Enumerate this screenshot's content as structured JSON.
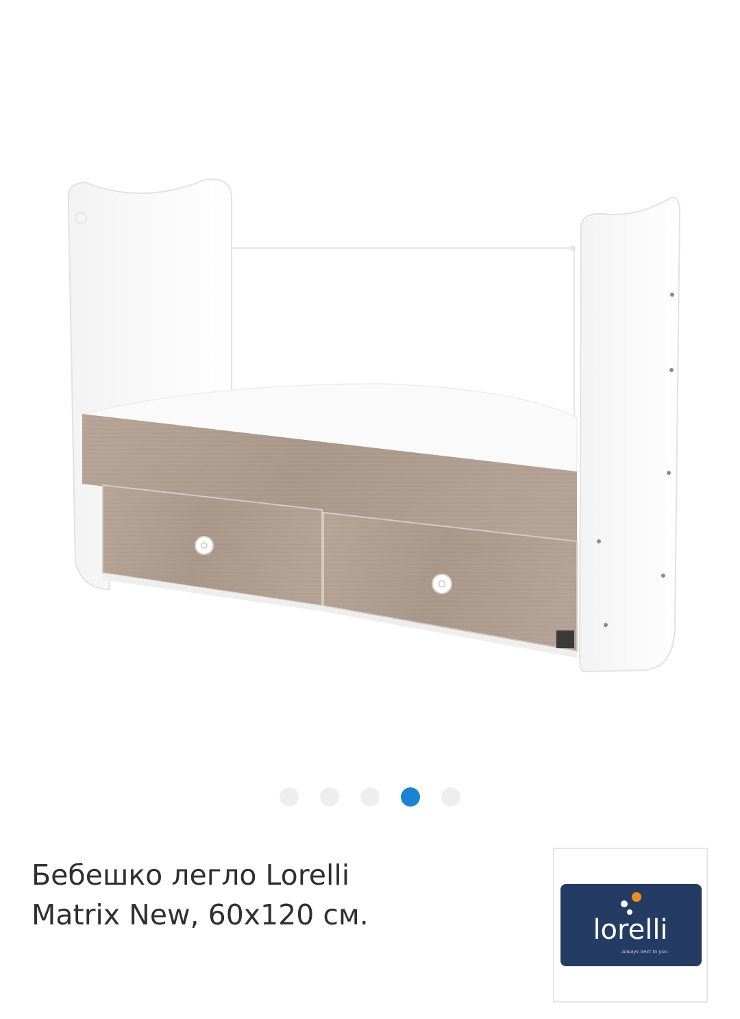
{
  "gallery": {
    "image_alt": "Бебешко легло Lorelli Matrix New, 60x120 см.",
    "dots": [
      {
        "active": false
      },
      {
        "active": false
      },
      {
        "active": false
      },
      {
        "active": true
      },
      {
        "active": false
      }
    ],
    "active_index": 3,
    "active_color": "#1b83d3",
    "inactive_color": "#eeeeee"
  },
  "product": {
    "title_line1": "Бебешко легло Lorelli",
    "title_line2": "Matrix New, 60x120 см."
  },
  "brand": {
    "logo_text": "lorelli",
    "tagline": "Always next to you",
    "logo_bg_color": "#243c63",
    "logo_dot_color": "#f08a24"
  }
}
